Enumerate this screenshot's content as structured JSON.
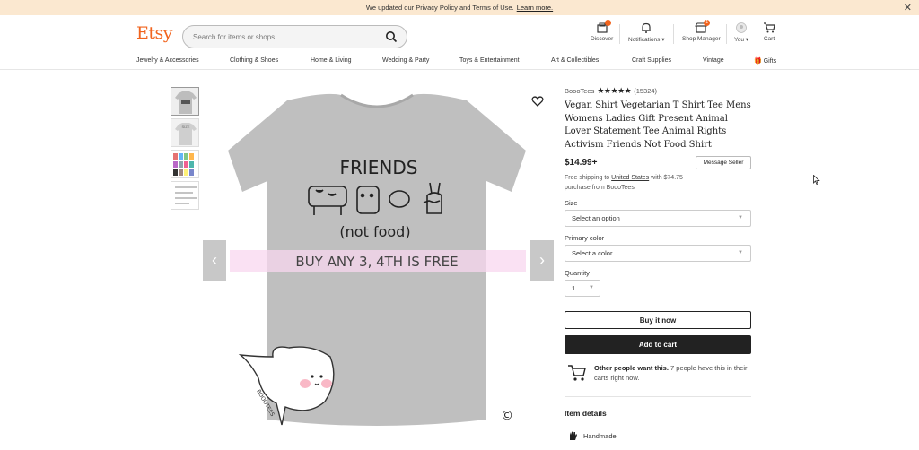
{
  "banner": {
    "text": "We updated our Privacy Policy and Terms of Use.",
    "link": "Learn more.",
    "close": "✕"
  },
  "header": {
    "logo": "Etsy",
    "search_placeholder": "Search for items or shops",
    "nav": [
      {
        "label": "Discover",
        "icon": "discover-icon"
      },
      {
        "label": "Notifications ▾",
        "icon": "bell-icon"
      },
      {
        "label": "Shop Manager",
        "icon": "shop-icon",
        "badge": "1"
      },
      {
        "label": "You ▾",
        "icon": "avatar-icon"
      },
      {
        "label": "Cart",
        "icon": "cart-icon"
      }
    ]
  },
  "categories": [
    "Jewelry & Accessories",
    "Clothing & Shoes",
    "Home & Living",
    "Wedding & Party",
    "Toys & Entertainment",
    "Art & Collectibles",
    "Craft Supplies",
    "Vintage",
    "Gifts"
  ],
  "product": {
    "shop": "BoooTees",
    "stars": "★★★★★",
    "reviews": "(15324)",
    "title": "Vegan Shirt Vegetarian T Shirt Tee Mens Womens Ladies Gift Present Animal Lover Statement Tee Animal Rights Activism Friends Not Food Shirt",
    "price": "$14.99+",
    "message_seller": "Message Seller",
    "shipping_pre": "Free shipping to ",
    "shipping_country": "United States",
    "shipping_post": " with $74.75 purchase from BoooTees",
    "size_label": "Size",
    "size_value": "Select an option",
    "color_label": "Primary color",
    "color_value": "Select a color",
    "qty_label": "Quantity",
    "qty_value": "1",
    "buy_now": "Buy it now",
    "add_to_cart": "Add to cart",
    "others_bold": "Other people want this.",
    "others_rest": " 7 people have this in their carts right now.",
    "item_details": "Item details",
    "handmade": "Handmade"
  },
  "image": {
    "shirt_text_1": "FRIENDS",
    "shirt_text_2": "(not food)",
    "promo": "BUY ANY 3, 4TH IS FREE",
    "mascot_text": "BOOOTEES",
    "copyright": "©"
  }
}
